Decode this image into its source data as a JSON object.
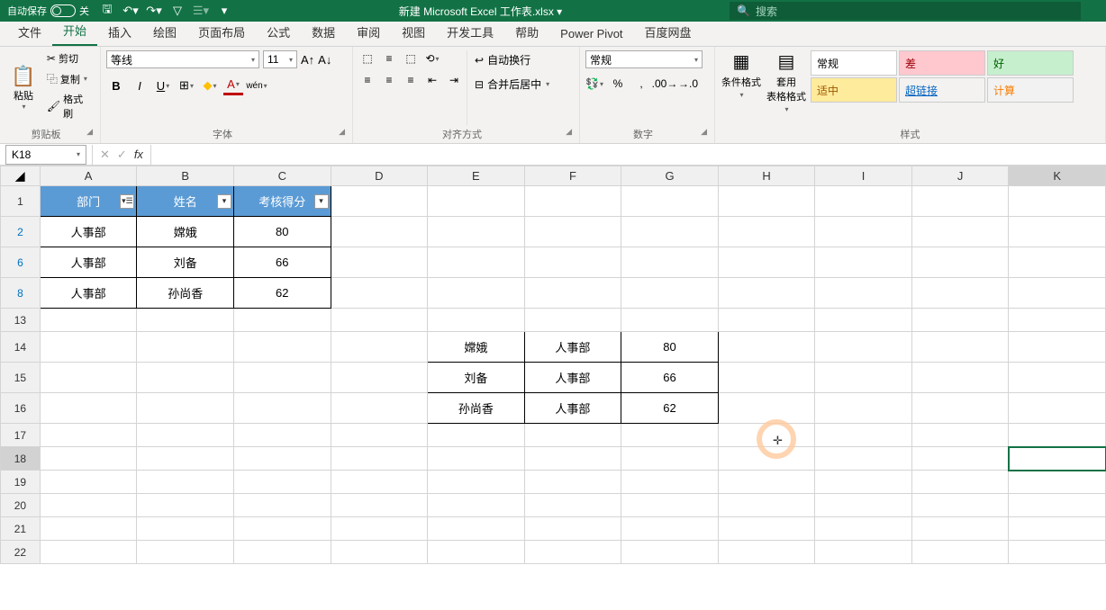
{
  "titlebar": {
    "autosave_label": "自动保存",
    "autosave_state": "关",
    "doc_title": "新建 Microsoft Excel 工作表.xlsx ▾",
    "search_placeholder": "搜索"
  },
  "tabs": {
    "file": "文件",
    "home": "开始",
    "insert": "插入",
    "draw": "绘图",
    "layout": "页面布局",
    "formulas": "公式",
    "data": "数据",
    "review": "审阅",
    "view": "视图",
    "developer": "开发工具",
    "help": "帮助",
    "powerpivot": "Power Pivot",
    "baidu": "百度网盘"
  },
  "ribbon": {
    "clipboard": {
      "paste": "粘贴",
      "cut": "剪切",
      "copy": "复制",
      "painter": "格式刷",
      "group": "剪贴板"
    },
    "font": {
      "name": "等线",
      "size": "11",
      "group": "字体"
    },
    "align": {
      "wrap": "自动换行",
      "merge": "合并后居中",
      "group": "对齐方式"
    },
    "number": {
      "format": "常规",
      "group": "数字"
    },
    "styles": {
      "cond": "条件格式",
      "table": "套用\n表格格式",
      "group": "样式",
      "normal": "常规",
      "bad": "差",
      "good": "好",
      "neutral": "适中",
      "link": "超链接",
      "calc": "计算"
    }
  },
  "formula_bar": {
    "name_box": "K18",
    "formula": ""
  },
  "grid": {
    "cols": [
      "A",
      "B",
      "C",
      "D",
      "E",
      "F",
      "G",
      "H",
      "I",
      "J",
      "K"
    ],
    "visible_rows": [
      "1",
      "2",
      "6",
      "8",
      "13",
      "14",
      "15",
      "16",
      "17",
      "18",
      "19",
      "20",
      "21",
      "22"
    ],
    "filtered_rows": [
      "2",
      "6",
      "8"
    ]
  },
  "table1": {
    "headers": [
      "部门",
      "姓名",
      "考核得分"
    ],
    "rows": [
      {
        "row": "2",
        "dept": "人事部",
        "name": "嫦娥",
        "score": "80"
      },
      {
        "row": "6",
        "dept": "人事部",
        "name": "刘备",
        "score": "66"
      },
      {
        "row": "8",
        "dept": "人事部",
        "name": "孙尚香",
        "score": "62"
      }
    ]
  },
  "table2": {
    "rows": [
      {
        "name": "嫦娥",
        "dept": "人事部",
        "score": "80"
      },
      {
        "name": "刘备",
        "dept": "人事部",
        "score": "66"
      },
      {
        "name": "孙尚香",
        "dept": "人事部",
        "score": "62"
      }
    ]
  }
}
